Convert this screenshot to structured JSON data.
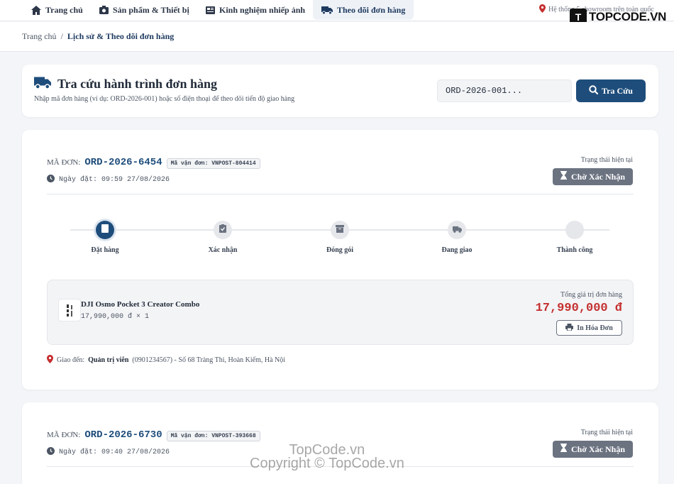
{
  "nav": {
    "items": [
      {
        "label": "Trang chủ",
        "icon": "home-icon"
      },
      {
        "label": "Sản phẩm & Thiết bị",
        "icon": "camera-icon"
      },
      {
        "label": "Kinh nghiệm nhiếp ảnh",
        "icon": "newspaper-icon"
      },
      {
        "label": "Theo dõi đơn hàng",
        "icon": "truck-icon",
        "active": true
      }
    ],
    "showroom": "Hệ thống 5 showroom trên toàn quốc",
    "logo_text": "TOPCODE.VN",
    "logo_mark": "T"
  },
  "breadcrumb": {
    "home": "Trang chủ",
    "separator": "/",
    "current": "Lịch sử & Theo dõi đơn hàng"
  },
  "search": {
    "title": "Tra cứu hành trình đơn hàng",
    "subtitle": "Nhập mã đơn hàng (ví dụ: ORD-2026-001) hoặc số điện thoại để theo dõi tiến độ giao hàng",
    "input_value": "ORD-2026-001...",
    "button": "Tra Cứu"
  },
  "orders": [
    {
      "code_label": "MÃ ĐƠN:",
      "code": "ORD-2026-6454",
      "shipping": "Mã vận đơn: VNPOST-804414",
      "date": "Ngày đặt: 09:59 27/08/2026",
      "status_label": "Trạng thái hiện tại",
      "status": "Chờ Xác Nhận",
      "steps": [
        "Đặt hàng",
        "Xác nhận",
        "Đóng gói",
        "Đang giao",
        "Thành công"
      ],
      "active_step": 0,
      "item_name": "DJI Osmo Pocket 3 Creator Combo",
      "item_price": "17,990,000 đ × 1",
      "total_label": "Tổng giá trị đơn hàng",
      "total": "17,990,000 đ",
      "print": "In Hóa Đơn",
      "addr_prefix": "Giao đến:",
      "addr_name": "Quản trị viên",
      "addr_rest": "(0901234567) - Số 68 Tràng Thi, Hoàn Kiếm, Hà Nội"
    },
    {
      "code_label": "MÃ ĐƠN:",
      "code": "ORD-2026-6730",
      "shipping": "Mã vận đơn: VNPOST-393668",
      "date": "Ngày đặt: 09:40 27/08/2026",
      "status_label": "Trạng thái hiện tại",
      "status": "Chờ Xác Nhận"
    }
  ],
  "watermark": {
    "line1": "TopCode.vn",
    "line2": "Copyright © TopCode.vn"
  },
  "colors": {
    "primary": "#1e4d7b",
    "price": "#c53030",
    "status": "#6b7280"
  }
}
